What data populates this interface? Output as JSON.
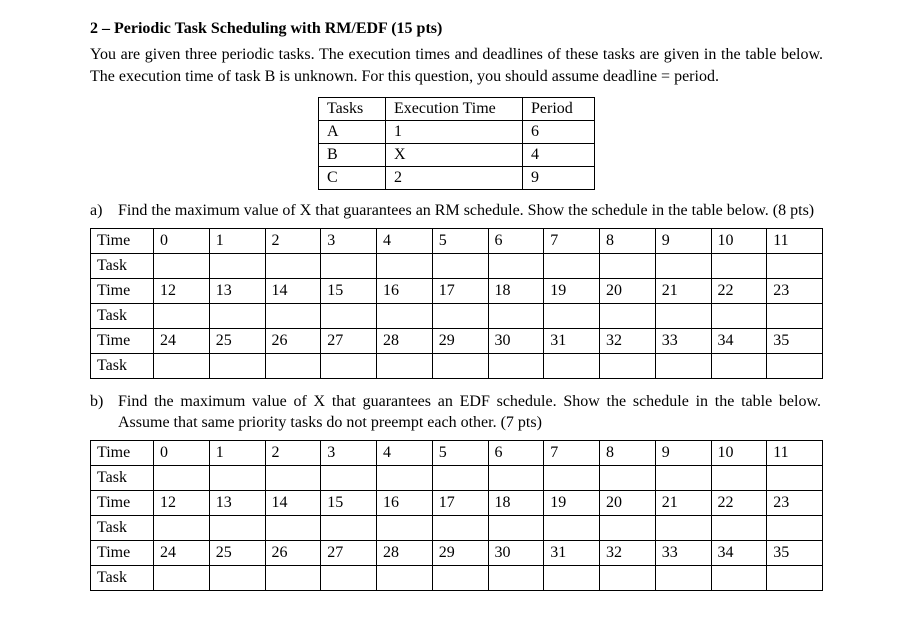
{
  "title": "2 – Periodic Task Scheduling with RM/EDF (15 pts)",
  "intro": "You are given three periodic tasks. The execution times and deadlines of these tasks are given in the table below. The execution time of task B is unknown. For this question, you should assume deadline = period.",
  "task_table": {
    "headers": {
      "tasks": "Tasks",
      "exec": "Execution Time",
      "period": "Period"
    },
    "rows": [
      {
        "task": "A",
        "exec": "1",
        "period": "6"
      },
      {
        "task": "B",
        "exec": "X",
        "period": "4"
      },
      {
        "task": "C",
        "exec": "2",
        "period": "9"
      }
    ]
  },
  "part_a": {
    "label": "a)",
    "text": "Find the maximum value of X that guarantees an RM schedule. Show the schedule in the table below. (8 pts)"
  },
  "part_b": {
    "label": "b)",
    "text": "Find the maximum value of X that guarantees an EDF schedule. Show the schedule in the table below. Assume that same priority tasks do not preempt each other. (7 pts)"
  },
  "sched_labels": {
    "time": "Time",
    "task": "Task"
  },
  "sched_rows": [
    [
      "0",
      "1",
      "2",
      "3",
      "4",
      "5",
      "6",
      "7",
      "8",
      "9",
      "10",
      "11"
    ],
    [
      "12",
      "13",
      "14",
      "15",
      "16",
      "17",
      "18",
      "19",
      "20",
      "21",
      "22",
      "23"
    ],
    [
      "24",
      "25",
      "26",
      "27",
      "28",
      "29",
      "30",
      "31",
      "32",
      "33",
      "34",
      "35"
    ]
  ]
}
